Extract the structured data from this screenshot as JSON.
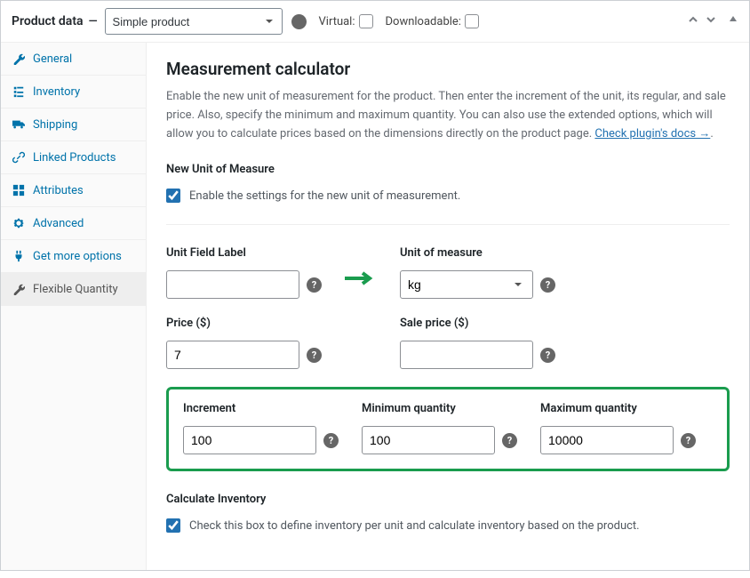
{
  "header": {
    "title": "Product data",
    "dash": "—",
    "product_type_selected": "Simple product",
    "virtual_label": "Virtual:",
    "virtual_checked": false,
    "downloadable_label": "Downloadable:",
    "downloadable_checked": false
  },
  "tabs": [
    {
      "icon": "wrench",
      "label": "General"
    },
    {
      "icon": "list",
      "label": "Inventory"
    },
    {
      "icon": "truck",
      "label": "Shipping"
    },
    {
      "icon": "link",
      "label": "Linked Products"
    },
    {
      "icon": "grid",
      "label": "Attributes"
    },
    {
      "icon": "gear",
      "label": "Advanced"
    },
    {
      "icon": "plug",
      "label": "Get more options"
    },
    {
      "icon": "wrench-solid",
      "label": "Flexible Quantity",
      "active": true
    }
  ],
  "main": {
    "heading": "Measurement calculator",
    "description_pre": "Enable the new unit of measurement for the product. Then enter the increment of the unit, its regular, and sale price. Also, specify the minimum and maximum quantity. You can also use the extended options, which will allow you to calculate prices based on the dimensions directly on the product page. ",
    "docs_link": "Check plugin's docs →",
    "description_post": ".",
    "new_unit_heading": "New Unit of Measure",
    "enable_label": "Enable the settings for the new unit of measurement.",
    "enable_checked": true,
    "fields": {
      "unit_field_label": {
        "label": "Unit Field Label",
        "value": ""
      },
      "unit_of_measure": {
        "label": "Unit of measure",
        "value": "kg"
      },
      "price": {
        "label": "Price ($)",
        "value": "7"
      },
      "sale_price": {
        "label": "Sale price ($)",
        "value": ""
      },
      "increment": {
        "label": "Increment",
        "value": "100"
      },
      "min_qty": {
        "label": "Minimum quantity",
        "value": "100"
      },
      "max_qty": {
        "label": "Maximum quantity",
        "value": "10000"
      }
    },
    "calc_inventory_heading": "Calculate Inventory",
    "calc_inventory_label": "Check this box to define inventory per unit and calculate inventory based on the product.",
    "calc_inventory_checked": true
  }
}
